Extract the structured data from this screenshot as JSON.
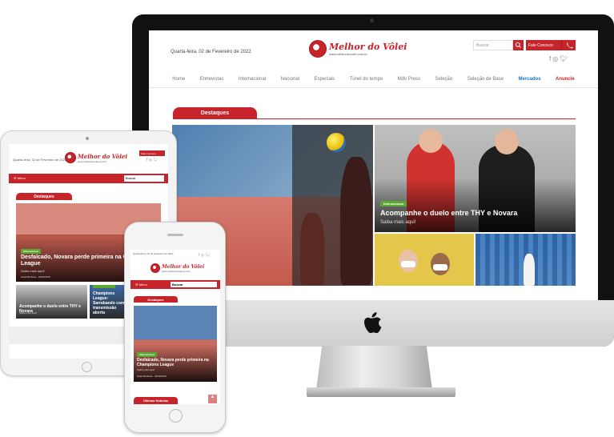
{
  "site": {
    "logo_text": "Melhor do Vôlei",
    "logo_url": "www.melhordovolei.com.br",
    "date": "Quarta-feira, 02 de Fevereiro de 2022",
    "search_placeholder": "Buscar",
    "contact_label": "Fale Conosco",
    "nav": [
      "Home",
      "Entrevistas",
      "Internacional",
      "Nacional",
      "Especiais",
      "Túnel do tempo",
      "Mdv Press",
      "Seleção",
      "Seleção de Base",
      "Mercados",
      "Anuncie"
    ],
    "section_title": "Destaques",
    "brand_color": "#c7232a",
    "badge_color": "#5aa832"
  },
  "desktop": {
    "card_top": {
      "badge": "Internacional",
      "title": "Acompanhe o duelo entre THY e Novara",
      "subtitle": "Saiba mais aqui!"
    }
  },
  "tablet": {
    "menu_label": "Menu",
    "search_value": "Buscar",
    "hero": {
      "title": "Desfalcado, Novara perde primeira na Champions League",
      "subtitle": "Saiba mais aqui!",
      "author": "Israel Barbosa",
      "date": "02/02/2022"
    },
    "card_left": {
      "title": "Acompanhe o duelo entre THY e Novara",
      "subtitle": "Saiba mais aqui!"
    },
    "card_right": {
      "title": "Champions League: Sarrabando com transmissão aberta"
    }
  },
  "phone": {
    "menu_label": "Menu",
    "search_value": "Buscar",
    "hero": {
      "badge": "Internacional",
      "title": "Desfalcado, Novara perde primeira na Champions League",
      "subtitle": "Saiba mais aqui!",
      "author": "Israel Barbosa",
      "date": "02/02/2022"
    },
    "latest_title": "Últimas Notícias"
  }
}
